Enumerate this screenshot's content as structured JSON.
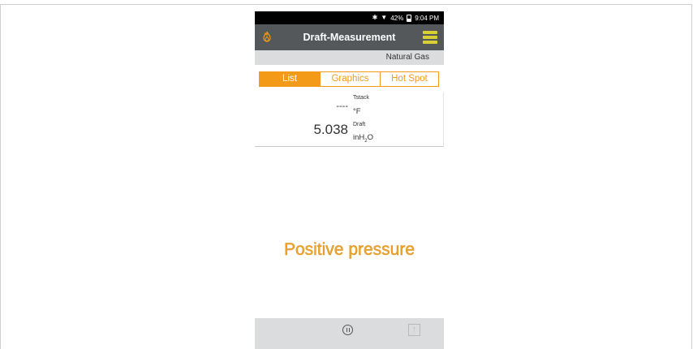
{
  "status": {
    "bluetooth_icon": "bluetooth-icon",
    "wifi_icon": "wifi-icon",
    "battery": "42%",
    "time": "9:04 PM"
  },
  "header": {
    "title": "Draft-Measurement",
    "left_icon": "flame-icon",
    "right_icon": "menu-icon",
    "menu_color": "#d7d035"
  },
  "fuel": "Natural Gas",
  "tabs": [
    {
      "label": "List",
      "active": true
    },
    {
      "label": "Graphics",
      "active": false
    },
    {
      "label": "Hot Spot",
      "active": false
    }
  ],
  "readings": {
    "tstack": {
      "value": "----",
      "label": "Tstack",
      "unit": "°F"
    },
    "draft": {
      "value": "5.038",
      "label": "Draft",
      "unit_main": "inH",
      "unit_sub": "2",
      "unit_tail": "O"
    }
  },
  "message": "Positive pressure",
  "colors": {
    "accent": "#f39a19",
    "titlebar": "#55585b",
    "message": "#f3a62a"
  },
  "footer": {
    "pause_icon": "pause-icon",
    "upload_icon": "upload-icon"
  }
}
